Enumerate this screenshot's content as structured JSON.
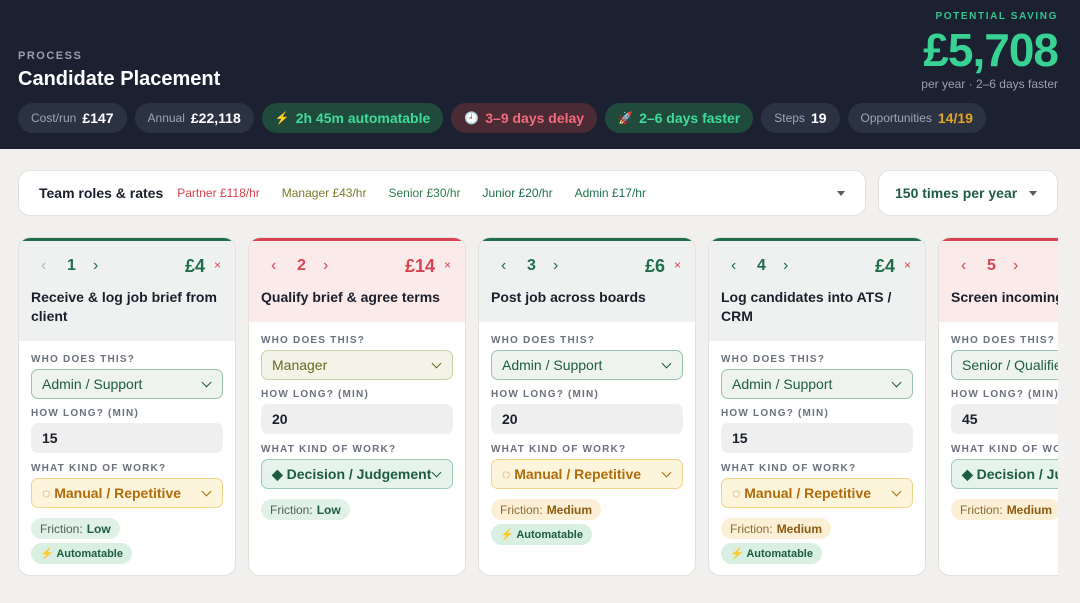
{
  "header": {
    "process_label": "PROCESS",
    "process_title": "Candidate Placement",
    "saving_label": "POTENTIAL SAVING",
    "saving_amount": "£5,708",
    "saving_sub": "per year · 2–6 days faster"
  },
  "pills": {
    "cost_label": "Cost/run",
    "cost_value": "£147",
    "annual_label": "Annual",
    "annual_value": "£22,118",
    "automatable_icon": "lightning-icon",
    "automatable": "2h 45m automatable",
    "delay_icon": "clock-icon",
    "delay": "3–9 days delay",
    "faster_icon": "rocket-icon",
    "faster": "2–6 days faster",
    "steps_label": "Steps",
    "steps_value": "19",
    "opps_label": "Opportunities",
    "opps_value": "14/19"
  },
  "roles": {
    "title": "Team roles & rates",
    "items": [
      {
        "label": "Partner £118/hr",
        "color": "#d9434f"
      },
      {
        "label": "Manager £43/hr",
        "color": "#7a7a2a"
      },
      {
        "label": "Senior £30/hr",
        "color": "#2f7d4f"
      },
      {
        "label": "Junior £20/hr",
        "color": "#1e6e4c"
      },
      {
        "label": "Admin £17/hr",
        "color": "#1e6e4c"
      }
    ]
  },
  "frequency": {
    "label": "150 times per year"
  },
  "labels": {
    "who": "WHO DOES THIS?",
    "how_long": "HOW LONG? (MIN)",
    "kind": "WHAT KIND OF WORK?",
    "friction": "Friction:",
    "automatable": "⚡ Automatable",
    "prev": "‹",
    "next": "›",
    "remove": "×"
  },
  "steps": [
    {
      "num": "1",
      "cost": "£4",
      "title": "Receive & log job brief from client",
      "who": "Admin / Support",
      "minutes": "15",
      "kind": "◌ Manual / Repetitive",
      "friction": "Low",
      "automatable": true
    },
    {
      "num": "2",
      "cost": "£14",
      "title": "Qualify brief & agree terms",
      "who": "Manager",
      "minutes": "20",
      "kind": "◆ Decision / Judgement",
      "friction": "Low",
      "automatable": false
    },
    {
      "num": "3",
      "cost": "£6",
      "title": "Post job across boards",
      "who": "Admin / Support",
      "minutes": "20",
      "kind": "◌ Manual / Repetitive",
      "friction": "Medium",
      "automatable": true
    },
    {
      "num": "4",
      "cost": "£4",
      "title": "Log candidates into ATS / CRM",
      "who": "Admin / Support",
      "minutes": "15",
      "kind": "◌ Manual / Repetitive",
      "friction": "Medium",
      "automatable": true
    },
    {
      "num": "5",
      "cost": "",
      "title": "Screen incoming",
      "who": "Senior / Qualified",
      "minutes": "45",
      "kind": "◆ Decision / Judgement",
      "friction": "Medium",
      "automatable": false
    }
  ]
}
